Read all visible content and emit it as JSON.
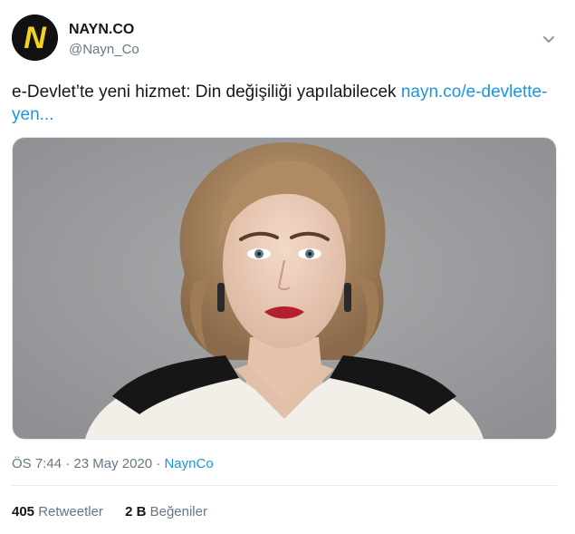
{
  "account": {
    "name": "NAYN.CO",
    "handle": "@Nayn_Co",
    "logo_letter": "N",
    "logo_color": "#f6d21c"
  },
  "tweet": {
    "text": "e-Devlet’te yeni hizmet: Din değişiliği yapılabilecek ",
    "link_text": "nayn.co/e-devlette-yen..."
  },
  "meta": {
    "time": "ÖS 7:44",
    "separator": " · ",
    "date": "23 May 2020",
    "source": "NaynCo"
  },
  "stats": {
    "retweets_count": "405",
    "retweets_label": "Retweetler",
    "likes_count": "2 B",
    "likes_label": "Beğeniler"
  },
  "colors": {
    "link": "#1b95e0",
    "secondary_text": "#657786",
    "divider": "#e6ecf0"
  },
  "icons": {
    "menu": "chevron-down-icon"
  }
}
